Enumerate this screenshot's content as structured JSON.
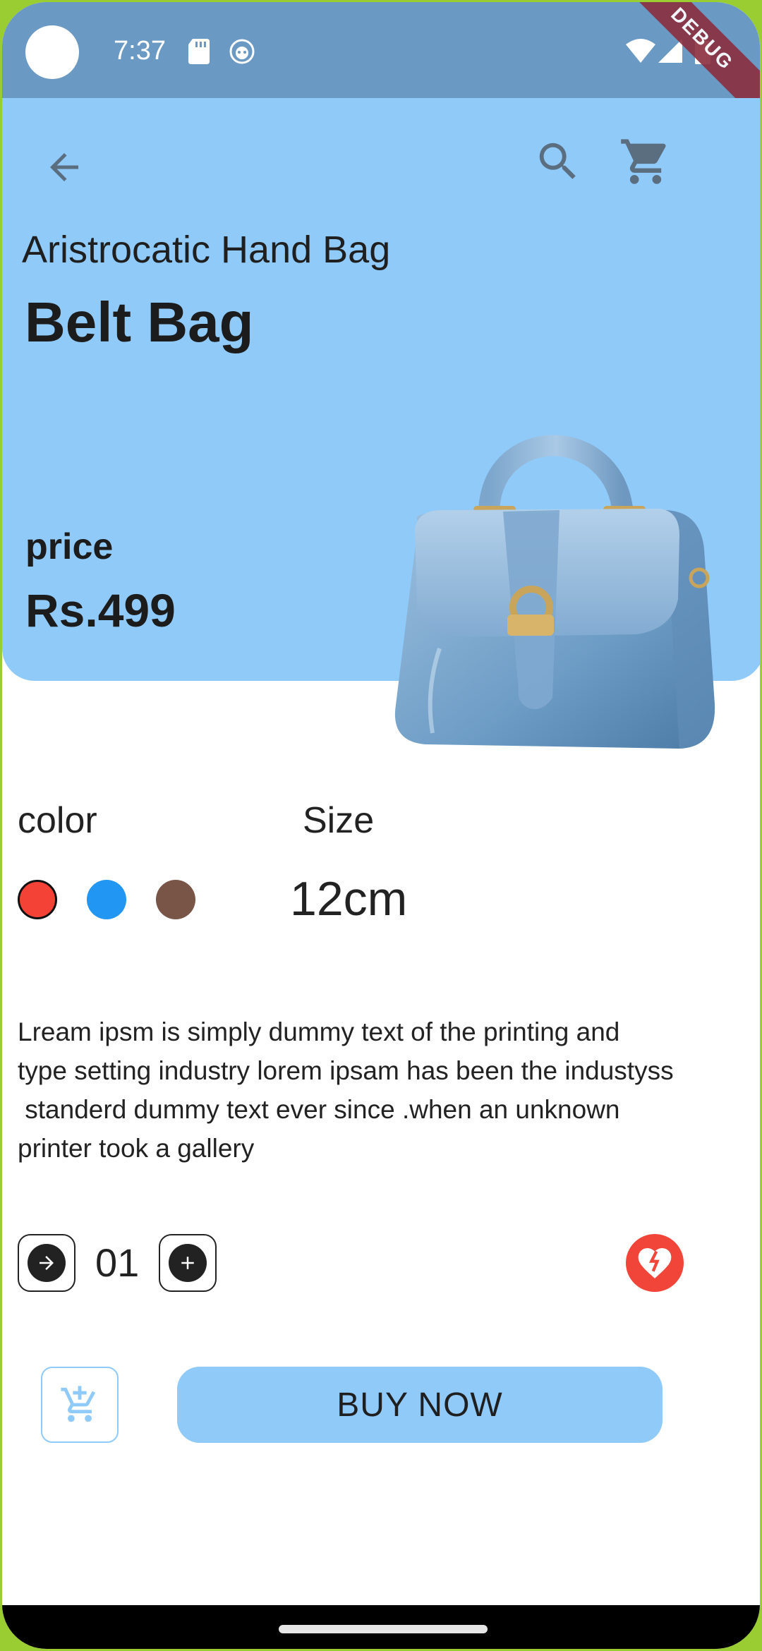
{
  "status_bar": {
    "time": "7:37",
    "debug_banner": "DEBUG"
  },
  "header": {
    "back_icon": "arrow-left-icon",
    "search_icon": "search-icon",
    "cart_icon": "cart-icon"
  },
  "product": {
    "subtitle": "Aristrocatic Hand Bag",
    "title": "Belt Bag",
    "price_label": "price",
    "price_value": "Rs.499",
    "image": "handbag-image"
  },
  "options": {
    "color_label": "color",
    "size_label": "Size",
    "size_value": "12cm",
    "colors": [
      "#f44336",
      "#2196f3",
      "#795548"
    ],
    "selected_color_index": 0
  },
  "description": "Lream ipsm is simply dummy text of the printing and\ntype setting industry lorem ipsam has been the industyss\n standerd dummy text ever since .when an unknown\nprinter took a gallery",
  "quantity": {
    "value": "01"
  },
  "actions": {
    "buy_now_label": "BUY NOW"
  },
  "colors": {
    "status_bar": "#6a99c4",
    "accent": "#90caf9",
    "favorite": "#f2453a"
  }
}
